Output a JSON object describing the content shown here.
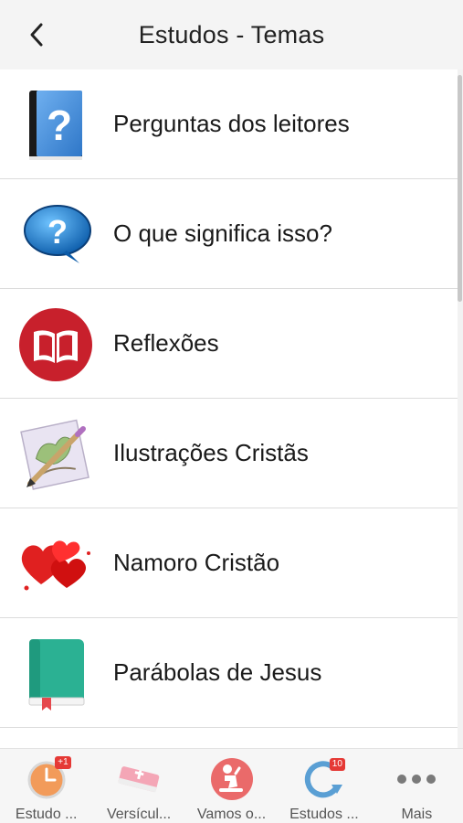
{
  "header": {
    "title": "Estudos - Temas"
  },
  "list": {
    "items": [
      {
        "label": "Perguntas dos leitores",
        "icon": "question-book-icon"
      },
      {
        "label": "O que significa isso?",
        "icon": "question-bubble-icon"
      },
      {
        "label": "Reflexões",
        "icon": "open-book-circle-icon"
      },
      {
        "label": "Ilustrações Cristãs",
        "icon": "pencil-drawing-icon"
      },
      {
        "label": "Namoro Cristão",
        "icon": "hearts-icon"
      },
      {
        "label": "Parábolas de Jesus",
        "icon": "green-book-icon"
      }
    ]
  },
  "tabbar": {
    "tabs": [
      {
        "label": "Estudo ...",
        "icon": "clock-icon",
        "badge": "+1"
      },
      {
        "label": "Versícul...",
        "icon": "bible-icon"
      },
      {
        "label": "Vamos o...",
        "icon": "praying-icon"
      },
      {
        "label": "Estudos ...",
        "icon": "refresh-download-icon",
        "badge": "10"
      },
      {
        "label": "Mais",
        "icon": "more-dots-icon"
      }
    ]
  },
  "colors": {
    "accent_red": "#c8202c",
    "teal": "#2bb193",
    "badge_red": "#e53935"
  }
}
